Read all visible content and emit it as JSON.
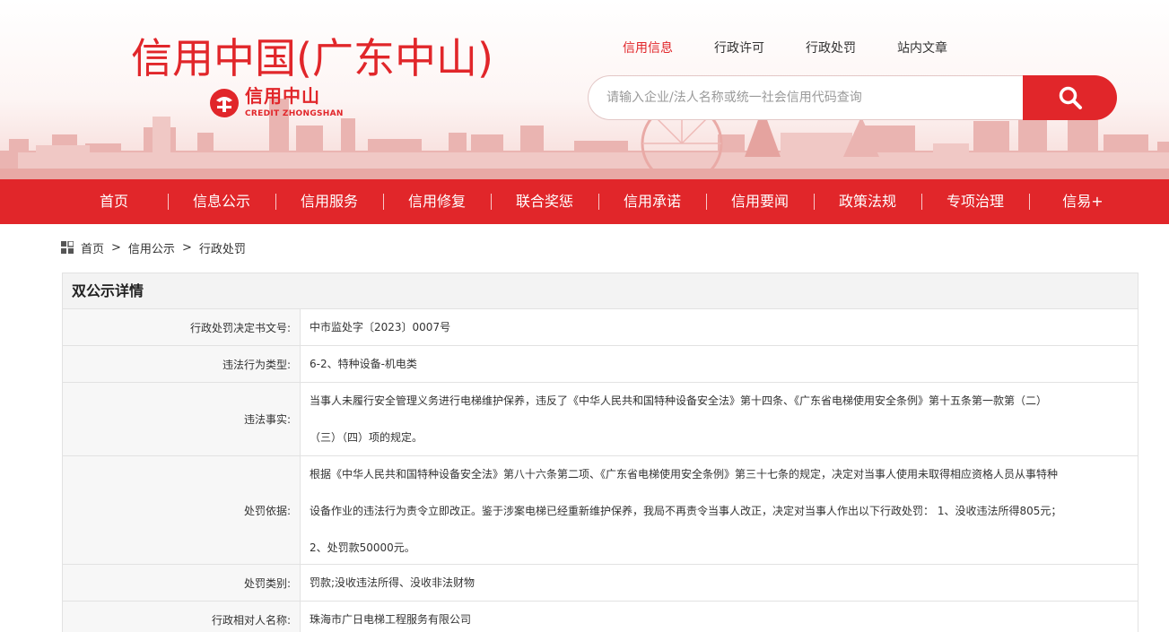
{
  "site": {
    "title": "信用中国(广东中山)",
    "logo_cn": "信用中山",
    "logo_en": "CREDIT ZHONGSHAN"
  },
  "top_tabs": [
    {
      "label": "信用信息",
      "active": true
    },
    {
      "label": "行政许可",
      "active": false
    },
    {
      "label": "行政处罚",
      "active": false
    },
    {
      "label": "站内文章",
      "active": false
    }
  ],
  "search": {
    "placeholder": "请输入企业/法人名称或统一社会信用代码查询",
    "value": "",
    "icon": "search-icon"
  },
  "nav": [
    {
      "label": "首页"
    },
    {
      "label": "信息公示"
    },
    {
      "label": "信用服务"
    },
    {
      "label": "信用修复"
    },
    {
      "label": "联合奖惩"
    },
    {
      "label": "信用承诺"
    },
    {
      "label": "信用要闻"
    },
    {
      "label": "政策法规"
    },
    {
      "label": "专项治理"
    },
    {
      "label": "信易+"
    }
  ],
  "breadcrumb": {
    "icon": "grid-icon",
    "items": [
      "首页",
      "信用公示",
      "行政处罚"
    ],
    "separator": ">"
  },
  "detail": {
    "heading": "双公示详情",
    "rows": [
      {
        "label": "行政处罚决定书文号:",
        "value": "中市监处字〔2023〕0007号"
      },
      {
        "label": "违法行为类型:",
        "value": "6-2、特种设备-机电类"
      },
      {
        "label": "违法事实:",
        "lines": [
          "当事人未履行安全管理义务进行电梯维护保养，违反了《中华人民共和国特种设备安全法》第十四条、《广东省电梯使用安全条例》第十五条第一款第（二）",
          "（三）（四）项的规定。"
        ]
      },
      {
        "label": "处罚依据:",
        "lines": [
          "根据《中华人民共和国特种设备安全法》第八十六条第二项、《广东省电梯使用安全条例》第三十七条的规定，决定对当事人使用未取得相应资格人员从事特种",
          "设备作业的违法行为责令立即改正。鉴于涉案电梯已经重新维护保养，我局不再责令当事人改正，决定对当事人作出以下行政处罚： 1、没收违法所得805元；",
          "2、处罚款50000元。"
        ]
      },
      {
        "label": "处罚类别:",
        "value": "罚款;没收违法所得、没收非法财物"
      },
      {
        "label": "行政相对人名称:",
        "value": "珠海市广日电梯工程服务有限公司"
      }
    ]
  },
  "colors": {
    "brand_red": "#e1262a",
    "label_bg": "#f7f7f7",
    "head_bg": "#f3f3f3",
    "border": "#e2e2e2"
  }
}
